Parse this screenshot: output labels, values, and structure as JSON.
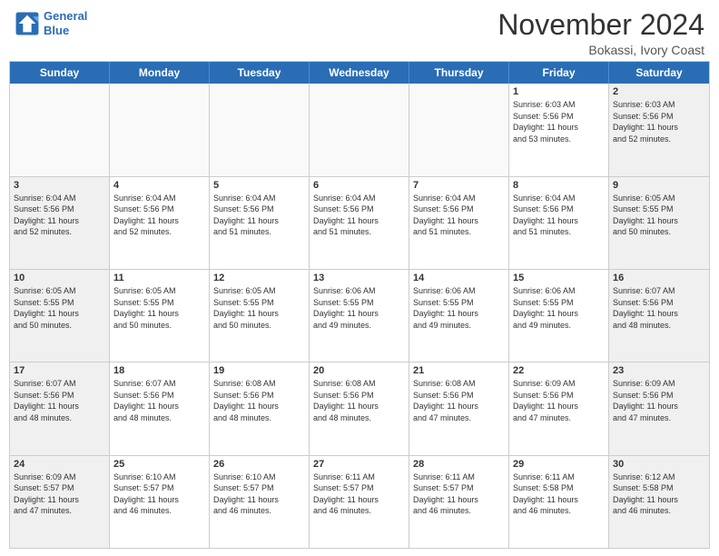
{
  "header": {
    "logo_line1": "General",
    "logo_line2": "Blue",
    "month": "November 2024",
    "location": "Bokassi, Ivory Coast"
  },
  "days_of_week": [
    "Sunday",
    "Monday",
    "Tuesday",
    "Wednesday",
    "Thursday",
    "Friday",
    "Saturday"
  ],
  "weeks": [
    [
      {
        "day": "",
        "info": "",
        "empty": true
      },
      {
        "day": "",
        "info": "",
        "empty": true
      },
      {
        "day": "",
        "info": "",
        "empty": true
      },
      {
        "day": "",
        "info": "",
        "empty": true
      },
      {
        "day": "",
        "info": "",
        "empty": true
      },
      {
        "day": "1",
        "info": "Sunrise: 6:03 AM\nSunset: 5:56 PM\nDaylight: 11 hours\nand 53 minutes.",
        "empty": false
      },
      {
        "day": "2",
        "info": "Sunrise: 6:03 AM\nSunset: 5:56 PM\nDaylight: 11 hours\nand 52 minutes.",
        "empty": false
      }
    ],
    [
      {
        "day": "3",
        "info": "Sunrise: 6:04 AM\nSunset: 5:56 PM\nDaylight: 11 hours\nand 52 minutes.",
        "empty": false
      },
      {
        "day": "4",
        "info": "Sunrise: 6:04 AM\nSunset: 5:56 PM\nDaylight: 11 hours\nand 52 minutes.",
        "empty": false
      },
      {
        "day": "5",
        "info": "Sunrise: 6:04 AM\nSunset: 5:56 PM\nDaylight: 11 hours\nand 51 minutes.",
        "empty": false
      },
      {
        "day": "6",
        "info": "Sunrise: 6:04 AM\nSunset: 5:56 PM\nDaylight: 11 hours\nand 51 minutes.",
        "empty": false
      },
      {
        "day": "7",
        "info": "Sunrise: 6:04 AM\nSunset: 5:56 PM\nDaylight: 11 hours\nand 51 minutes.",
        "empty": false
      },
      {
        "day": "8",
        "info": "Sunrise: 6:04 AM\nSunset: 5:56 PM\nDaylight: 11 hours\nand 51 minutes.",
        "empty": false
      },
      {
        "day": "9",
        "info": "Sunrise: 6:05 AM\nSunset: 5:55 PM\nDaylight: 11 hours\nand 50 minutes.",
        "empty": false
      }
    ],
    [
      {
        "day": "10",
        "info": "Sunrise: 6:05 AM\nSunset: 5:55 PM\nDaylight: 11 hours\nand 50 minutes.",
        "empty": false
      },
      {
        "day": "11",
        "info": "Sunrise: 6:05 AM\nSunset: 5:55 PM\nDaylight: 11 hours\nand 50 minutes.",
        "empty": false
      },
      {
        "day": "12",
        "info": "Sunrise: 6:05 AM\nSunset: 5:55 PM\nDaylight: 11 hours\nand 50 minutes.",
        "empty": false
      },
      {
        "day": "13",
        "info": "Sunrise: 6:06 AM\nSunset: 5:55 PM\nDaylight: 11 hours\nand 49 minutes.",
        "empty": false
      },
      {
        "day": "14",
        "info": "Sunrise: 6:06 AM\nSunset: 5:55 PM\nDaylight: 11 hours\nand 49 minutes.",
        "empty": false
      },
      {
        "day": "15",
        "info": "Sunrise: 6:06 AM\nSunset: 5:55 PM\nDaylight: 11 hours\nand 49 minutes.",
        "empty": false
      },
      {
        "day": "16",
        "info": "Sunrise: 6:07 AM\nSunset: 5:56 PM\nDaylight: 11 hours\nand 48 minutes.",
        "empty": false
      }
    ],
    [
      {
        "day": "17",
        "info": "Sunrise: 6:07 AM\nSunset: 5:56 PM\nDaylight: 11 hours\nand 48 minutes.",
        "empty": false
      },
      {
        "day": "18",
        "info": "Sunrise: 6:07 AM\nSunset: 5:56 PM\nDaylight: 11 hours\nand 48 minutes.",
        "empty": false
      },
      {
        "day": "19",
        "info": "Sunrise: 6:08 AM\nSunset: 5:56 PM\nDaylight: 11 hours\nand 48 minutes.",
        "empty": false
      },
      {
        "day": "20",
        "info": "Sunrise: 6:08 AM\nSunset: 5:56 PM\nDaylight: 11 hours\nand 48 minutes.",
        "empty": false
      },
      {
        "day": "21",
        "info": "Sunrise: 6:08 AM\nSunset: 5:56 PM\nDaylight: 11 hours\nand 47 minutes.",
        "empty": false
      },
      {
        "day": "22",
        "info": "Sunrise: 6:09 AM\nSunset: 5:56 PM\nDaylight: 11 hours\nand 47 minutes.",
        "empty": false
      },
      {
        "day": "23",
        "info": "Sunrise: 6:09 AM\nSunset: 5:56 PM\nDaylight: 11 hours\nand 47 minutes.",
        "empty": false
      }
    ],
    [
      {
        "day": "24",
        "info": "Sunrise: 6:09 AM\nSunset: 5:57 PM\nDaylight: 11 hours\nand 47 minutes.",
        "empty": false
      },
      {
        "day": "25",
        "info": "Sunrise: 6:10 AM\nSunset: 5:57 PM\nDaylight: 11 hours\nand 46 minutes.",
        "empty": false
      },
      {
        "day": "26",
        "info": "Sunrise: 6:10 AM\nSunset: 5:57 PM\nDaylight: 11 hours\nand 46 minutes.",
        "empty": false
      },
      {
        "day": "27",
        "info": "Sunrise: 6:11 AM\nSunset: 5:57 PM\nDaylight: 11 hours\nand 46 minutes.",
        "empty": false
      },
      {
        "day": "28",
        "info": "Sunrise: 6:11 AM\nSunset: 5:57 PM\nDaylight: 11 hours\nand 46 minutes.",
        "empty": false
      },
      {
        "day": "29",
        "info": "Sunrise: 6:11 AM\nSunset: 5:58 PM\nDaylight: 11 hours\nand 46 minutes.",
        "empty": false
      },
      {
        "day": "30",
        "info": "Sunrise: 6:12 AM\nSunset: 5:58 PM\nDaylight: 11 hours\nand 46 minutes.",
        "empty": false
      }
    ]
  ]
}
